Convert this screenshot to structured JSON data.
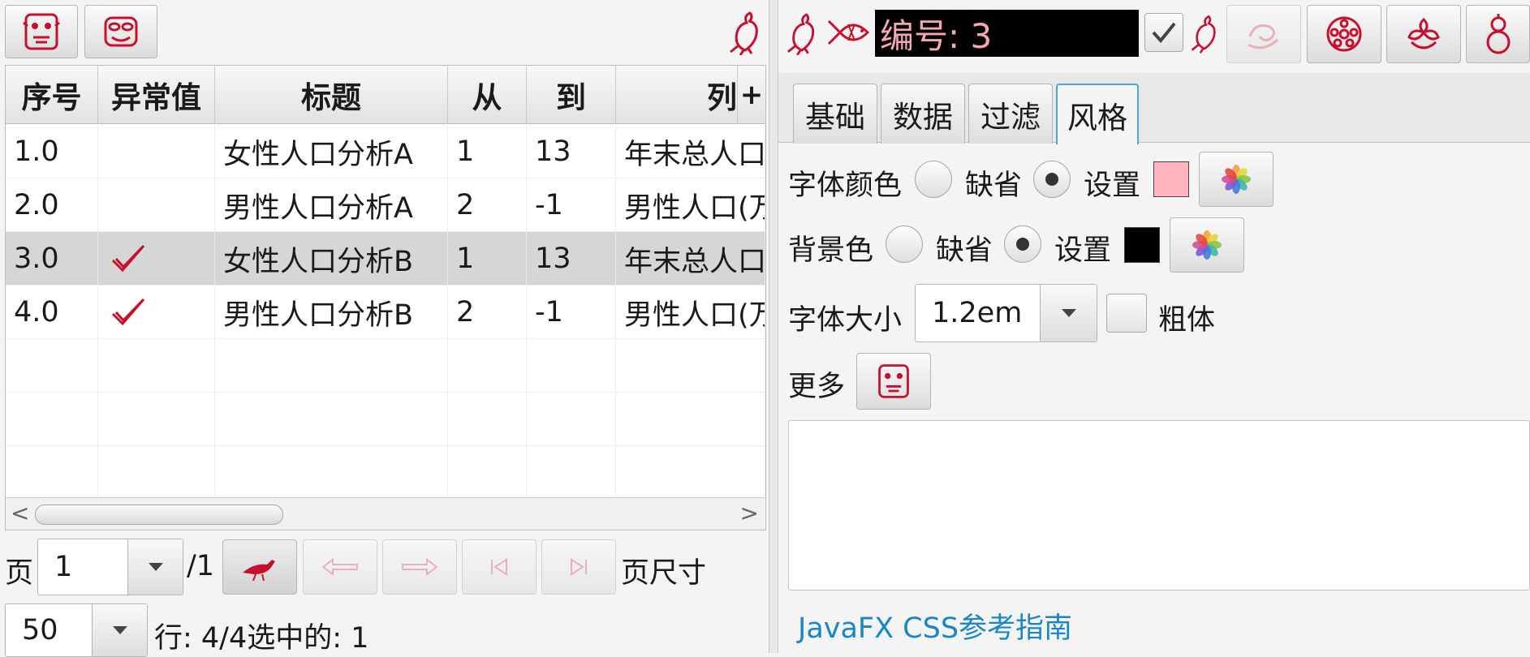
{
  "left_toolbar": {
    "icons": [
      "mask-icon",
      "mask-alt-icon"
    ],
    "corner_icon": "phoenix-icon"
  },
  "table": {
    "columns": [
      "序号",
      "异常值",
      "标题",
      "从",
      "到",
      "列"
    ],
    "add_column_glyph": "+",
    "rows": [
      {
        "index": "1.0",
        "anomaly": false,
        "title": "女性人口分析A",
        "from": "1",
        "to": "13",
        "col": "年末总人口"
      },
      {
        "index": "2.0",
        "anomaly": false,
        "title": "男性人口分析A",
        "from": "2",
        "to": "-1",
        "col": "男性人口(万"
      },
      {
        "index": "3.0",
        "anomaly": true,
        "title": "女性人口分析B",
        "from": "1",
        "to": "13",
        "col": "年末总人口"
      },
      {
        "index": "4.0",
        "anomaly": true,
        "title": "男性人口分析B",
        "from": "2",
        "to": "-1",
        "col": "男性人口(万"
      }
    ],
    "selected_row": 3,
    "scroll_left_glyph": "<",
    "scroll_right_glyph": ">"
  },
  "pagination": {
    "page_label": "页",
    "page_value": "1",
    "page_total": "/1",
    "page_size_label": "页尺寸",
    "page_size_value": "50",
    "status": "行: 4/4选中的: 1"
  },
  "right_toolbar": {
    "id_text": "编号: 3",
    "id_checked": true,
    "icons": [
      "phoenix-icon",
      "fish-icon",
      "swirl-icon",
      "lotus-root-icon",
      "flower-icon",
      "gourd-icon"
    ]
  },
  "tabs": [
    "基础",
    "数据",
    "过滤",
    "风格"
  ],
  "active_tab": 3,
  "style_panel": {
    "font_color_label": "字体颜色",
    "default_label": "缺省",
    "set_label": "设置",
    "font_color": "#ffb6c1",
    "font_color_mode": "set",
    "bg_color_label": "背景色",
    "bg_color": "#000000",
    "bg_color_mode": "set",
    "font_size_label": "字体大小",
    "font_size_value": "1.2em",
    "bold_label": "粗体",
    "bold_checked": false,
    "more_label": "更多",
    "more_text": "",
    "css_link": "JavaFX CSS参考指南"
  },
  "colors": {
    "accent_red": "#c8102e",
    "link_blue": "#1a86c8",
    "tab_focus": "#4aa6e0"
  }
}
